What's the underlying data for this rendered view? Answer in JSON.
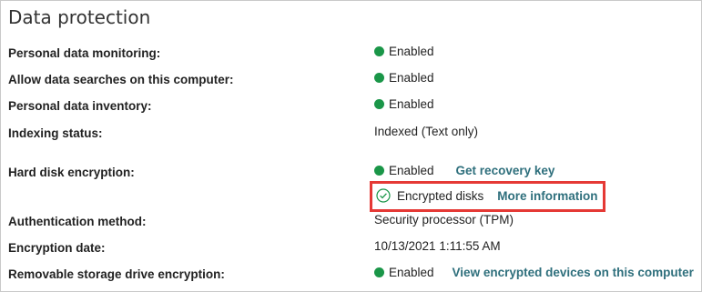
{
  "section": {
    "title": "Data protection"
  },
  "rows": [
    {
      "label": "Personal data monitoring:",
      "status": "Enabled"
    },
    {
      "label": "Allow data searches on this computer:",
      "status": "Enabled"
    },
    {
      "label": "Personal data inventory:",
      "status": "Enabled"
    },
    {
      "label": "Indexing status:",
      "value": "Indexed (Text only)"
    },
    {
      "label": "Hard disk encryption:",
      "status": "Enabled",
      "link": "Get recovery key"
    },
    {
      "encrypted_text": "Encrypted disks",
      "link": "More information"
    },
    {
      "label": "Authentication method:",
      "value": "Security processor (TPM)"
    },
    {
      "label": "Encryption date:",
      "value": "10/13/2021 1:11:55 AM"
    },
    {
      "label": "Removable storage drive encryption:",
      "status": "Enabled",
      "link": "View encrypted devices on this computer"
    }
  ],
  "colors": {
    "enabled_dot": "#1a9648",
    "link": "#2e6f7c",
    "highlight_border": "#e53935"
  }
}
